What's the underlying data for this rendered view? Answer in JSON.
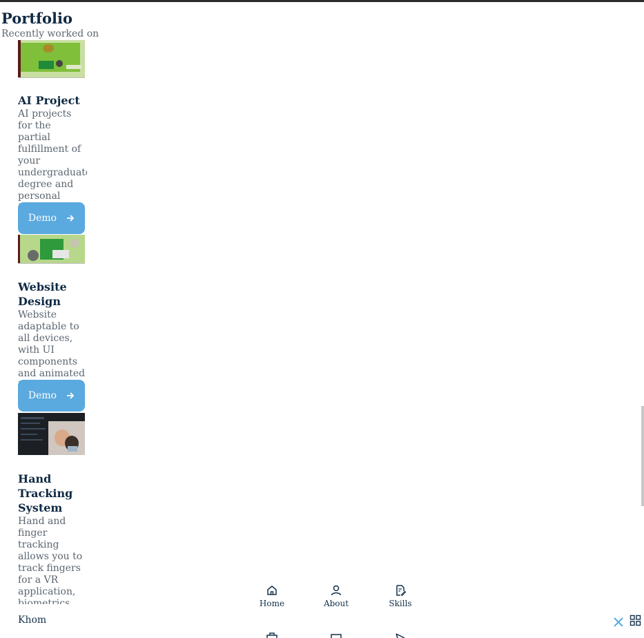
{
  "header": {
    "title": "Portfolio",
    "subtitle": "Recently worked on"
  },
  "projects": [
    {
      "title": "AI Project",
      "description": "AI projects for the partial fulfillment of your undergraduate degree and personal intersests.",
      "button_label": "Demo"
    },
    {
      "title": "Website Design",
      "description": "Website adaptable to all devices, with UI components and animated interactions.",
      "button_label": "Demo"
    },
    {
      "title": "Hand Tracking System",
      "description": "Hand and finger tracking allows you to track fingers for a VR application, biometrics, research, and"
    }
  ],
  "footer": {
    "name": "Khom"
  },
  "nav": {
    "items": [
      {
        "label": "Home",
        "icon": "home-icon"
      },
      {
        "label": "About",
        "icon": "user-icon"
      },
      {
        "label": "Skills",
        "icon": "file-edit-icon"
      }
    ],
    "close_icon": "close-icon",
    "menu_icon": "grid-icon"
  },
  "colors": {
    "accent": "#5aa9df",
    "title": "#0f2a44",
    "text_muted": "#5b6670"
  }
}
